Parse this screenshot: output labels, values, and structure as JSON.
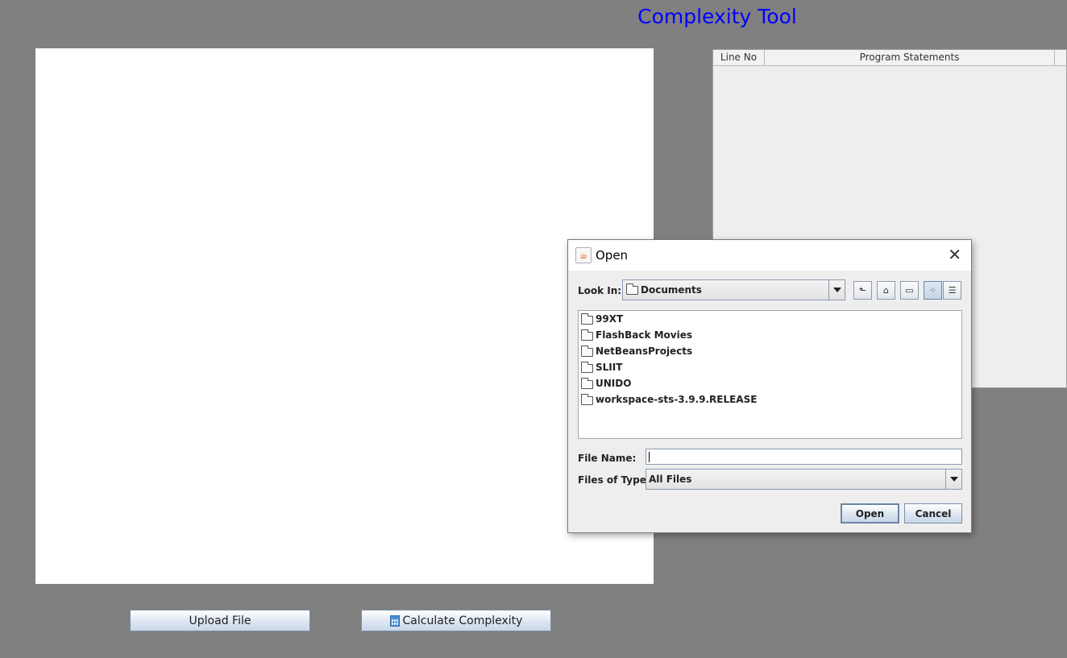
{
  "app": {
    "title": "Complexity Tool",
    "title_color": "#0000ff"
  },
  "table": {
    "columns": [
      "Line No",
      "Program Statements"
    ]
  },
  "buttons": {
    "upload": "Upload File",
    "calculate": "Calculate Complexity",
    "calculate_icon": "calculator-icon"
  },
  "dialog": {
    "title": "Open",
    "title_icon": "java-icon",
    "close": "✕",
    "look_in_label": "Look In:",
    "look_in_value": "Documents",
    "toolbar_icons": [
      "up-one-level-icon",
      "home-icon",
      "new-folder-icon",
      "list-view-icon",
      "details-view-icon"
    ],
    "files": [
      "99XT",
      "FlashBack Movies",
      "NetBeansProjects",
      "SLIIT",
      "UNIDO",
      "workspace-sts-3.9.9.RELEASE"
    ],
    "file_name_label": "File Name:",
    "file_name_value": "",
    "files_of_type_label": "Files of Type:",
    "files_of_type_value": "All Files",
    "open_button": "Open",
    "cancel_button": "Cancel"
  }
}
